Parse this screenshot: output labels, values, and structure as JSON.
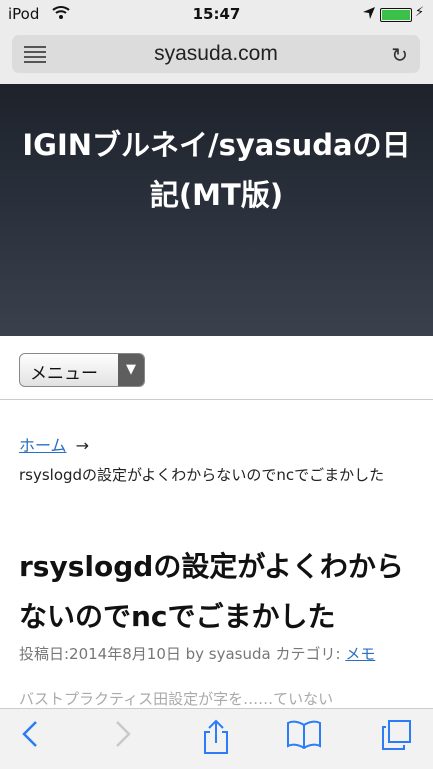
{
  "status": {
    "carrier": "iPod",
    "time": "15:47"
  },
  "browser": {
    "url": "syasuda.com"
  },
  "hero": {
    "title": "IGINブルネイ/syasudaの日記(MT版)"
  },
  "menu": {
    "label": "メニュー"
  },
  "breadcrumb": {
    "home": "ホーム",
    "arrow": "→",
    "current": "rsyslogdの設定がよくわからないのでncでごまかした"
  },
  "post": {
    "title": "rsyslogdの設定がよくわからないのでncでごまかした",
    "meta_prefix": "投稿日:2014年8月10日 by syasuda カテゴリ: ",
    "category": "メモ",
    "excerpt_fragment": "バストプラクティス田設定が字を……ていない"
  },
  "colors": {
    "accent": "#2b7cf6",
    "battery": "#3bc14a"
  }
}
